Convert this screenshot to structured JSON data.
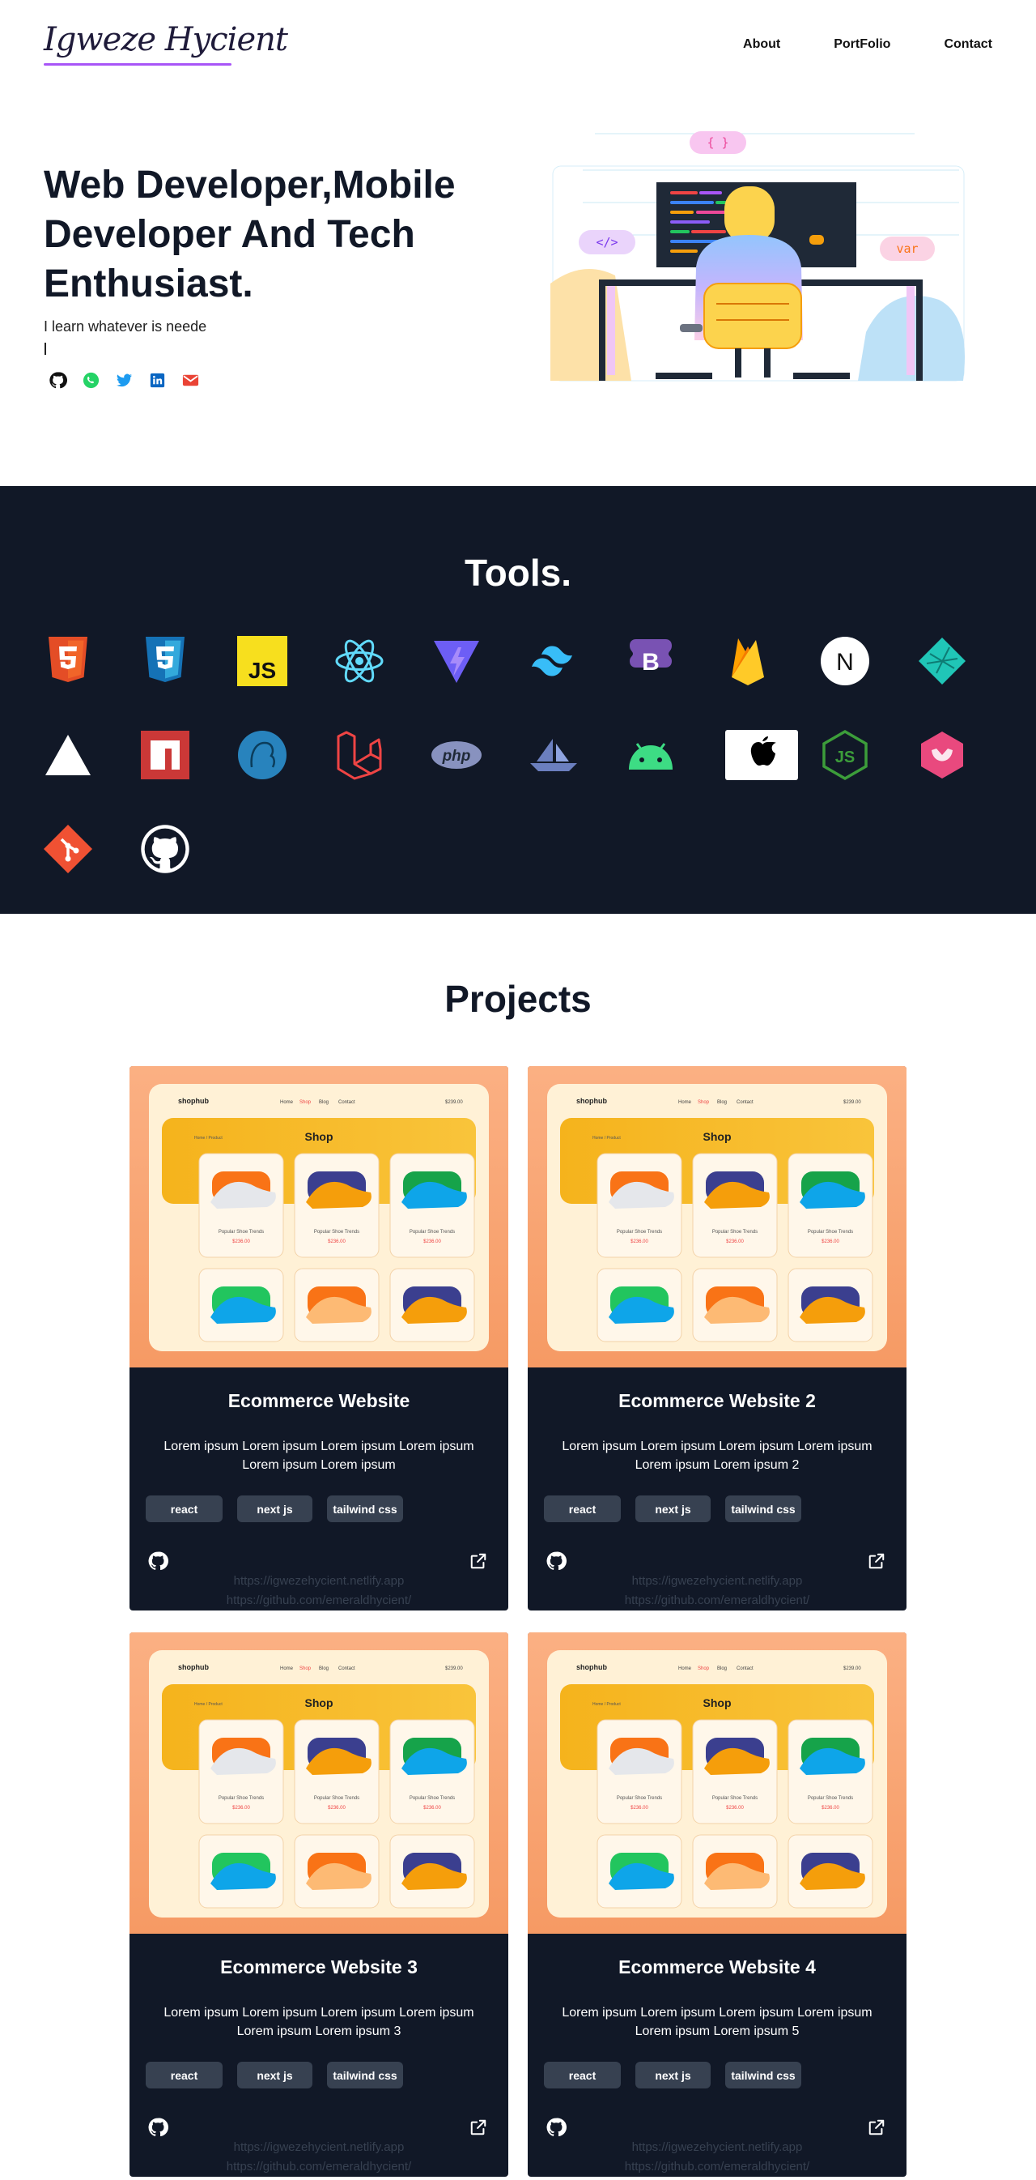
{
  "nav": {
    "logo": "Igweze Hycient",
    "links": [
      "About",
      "PortFolio",
      "Contact"
    ]
  },
  "hero": {
    "title": "Web Developer,Mobile Developer And Tech Enthusiast.",
    "subtitle": "I learn whatever is neede",
    "socials": [
      "github-icon",
      "whatsapp-icon",
      "twitter-icon",
      "linkedin-icon",
      "gmail-icon"
    ]
  },
  "tools": {
    "title": "Tools.",
    "items": [
      "html5",
      "css3",
      "javascript",
      "react",
      "vite",
      "tailwindcss",
      "bootstrap",
      "firebase",
      "nextjs",
      "netlify",
      "vercel",
      "npm",
      "mysql",
      "laravel",
      "php",
      "vagrant",
      "android",
      "apple",
      "nodejs",
      "sanity",
      "git",
      "github"
    ]
  },
  "projects": {
    "title": "Projects",
    "cards": [
      {
        "title": "Ecommerce Website",
        "description": "Lorem ipsum Lorem ipsum Lorem ipsum Lorem ipsum Lorem ipsum Lorem ipsum",
        "tags": [
          "react",
          "next js",
          "tailwind css"
        ],
        "live_url": "https://igwezehycient.netlify.app",
        "repo_url": "https://github.com/emeraldhycient/"
      },
      {
        "title": "Ecommerce Website 2",
        "description": "Lorem ipsum Lorem ipsum Lorem ipsum Lorem ipsum Lorem ipsum Lorem ipsum 2",
        "tags": [
          "react",
          "next js",
          "tailwind css"
        ],
        "live_url": "https://igwezehycient.netlify.app",
        "repo_url": "https://github.com/emeraldhycient/"
      },
      {
        "title": "Ecommerce Website 3",
        "description": "Lorem ipsum Lorem ipsum Lorem ipsum Lorem ipsum Lorem ipsum Lorem ipsum 3",
        "tags": [
          "react",
          "next js",
          "tailwind css"
        ],
        "live_url": "https://igwezehycient.netlify.app",
        "repo_url": "https://github.com/emeraldhycient/"
      },
      {
        "title": "Ecommerce Website 4",
        "description": "Lorem ipsum Lorem ipsum Lorem ipsum Lorem ipsum Lorem ipsum Lorem ipsum 5",
        "tags": [
          "react",
          "next js",
          "tailwind css"
        ],
        "live_url": "https://igwezehycient.netlify.app",
        "repo_url": "https://github.com/emeraldhycient/"
      }
    ],
    "mockup": {
      "brand": "shophub",
      "nav": [
        "Home",
        "Shop",
        "Blog",
        "Contact"
      ],
      "price": "$239.00",
      "heading": "Shop",
      "breadcrumb": "Home / Product",
      "product_name": "Popular Shoe Trends",
      "product_price": "$236.00"
    }
  },
  "colors": {
    "dark": "#111827",
    "accent_purple": "#a855f7",
    "tag_bg": "#374151"
  }
}
